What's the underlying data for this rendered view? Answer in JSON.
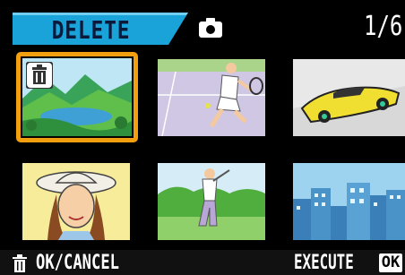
{
  "header": {
    "mode_label": "DELETE",
    "page_counter": "1/6",
    "mode_icon": "camera-icon",
    "tab_color": "#1aa3d8"
  },
  "thumbnails": [
    {
      "name": "thumbnail-landscape-lake",
      "selected": true,
      "marked_icon": "trash-icon"
    },
    {
      "name": "thumbnail-tennis-player",
      "selected": false
    },
    {
      "name": "thumbnail-sports-car",
      "selected": false
    },
    {
      "name": "thumbnail-woman-hat",
      "selected": false
    },
    {
      "name": "thumbnail-golfer",
      "selected": false
    },
    {
      "name": "thumbnail-city-skyline",
      "selected": false
    }
  ],
  "footer": {
    "ok_cancel_label": "OK/CANCEL",
    "execute_label": "EXECUTE",
    "ok_badge": "OK",
    "trash_icon": "trash-icon"
  },
  "colors": {
    "selection": "#f2a010",
    "tab": "#1aa3d8"
  }
}
